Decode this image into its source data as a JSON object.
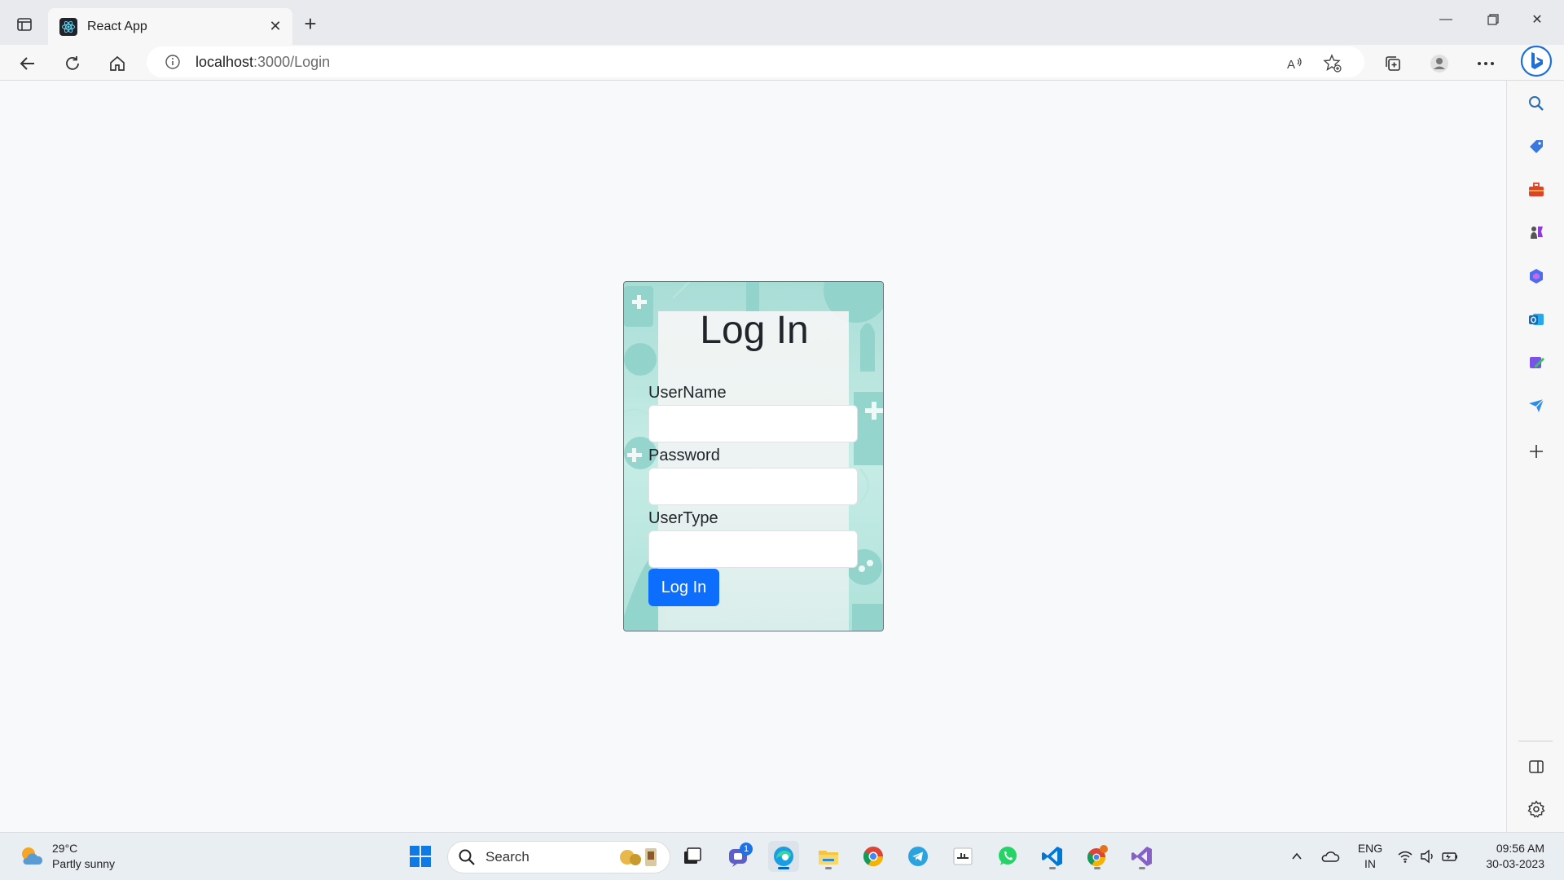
{
  "browser": {
    "tab_title": "React App",
    "address_host": "localhost",
    "address_path": ":3000/Login"
  },
  "login": {
    "heading": "Log In",
    "username_label": "UserName",
    "username_value": "",
    "password_label": "Password",
    "password_value": "",
    "usertype_label": "UserType",
    "usertype_value": "",
    "submit_label": "Log In"
  },
  "taskbar": {
    "weather_temp": "29°C",
    "weather_desc": "Partly sunny",
    "search_label": "Search",
    "teams_badge": "1",
    "lang_top": "ENG",
    "lang_bottom": "IN",
    "time": "09:56 AM",
    "date": "30-03-2023"
  },
  "colors": {
    "primary_button": "#0d6efd",
    "card_bg": "#a8ddd6",
    "page_bg": "#f8f9fa"
  }
}
